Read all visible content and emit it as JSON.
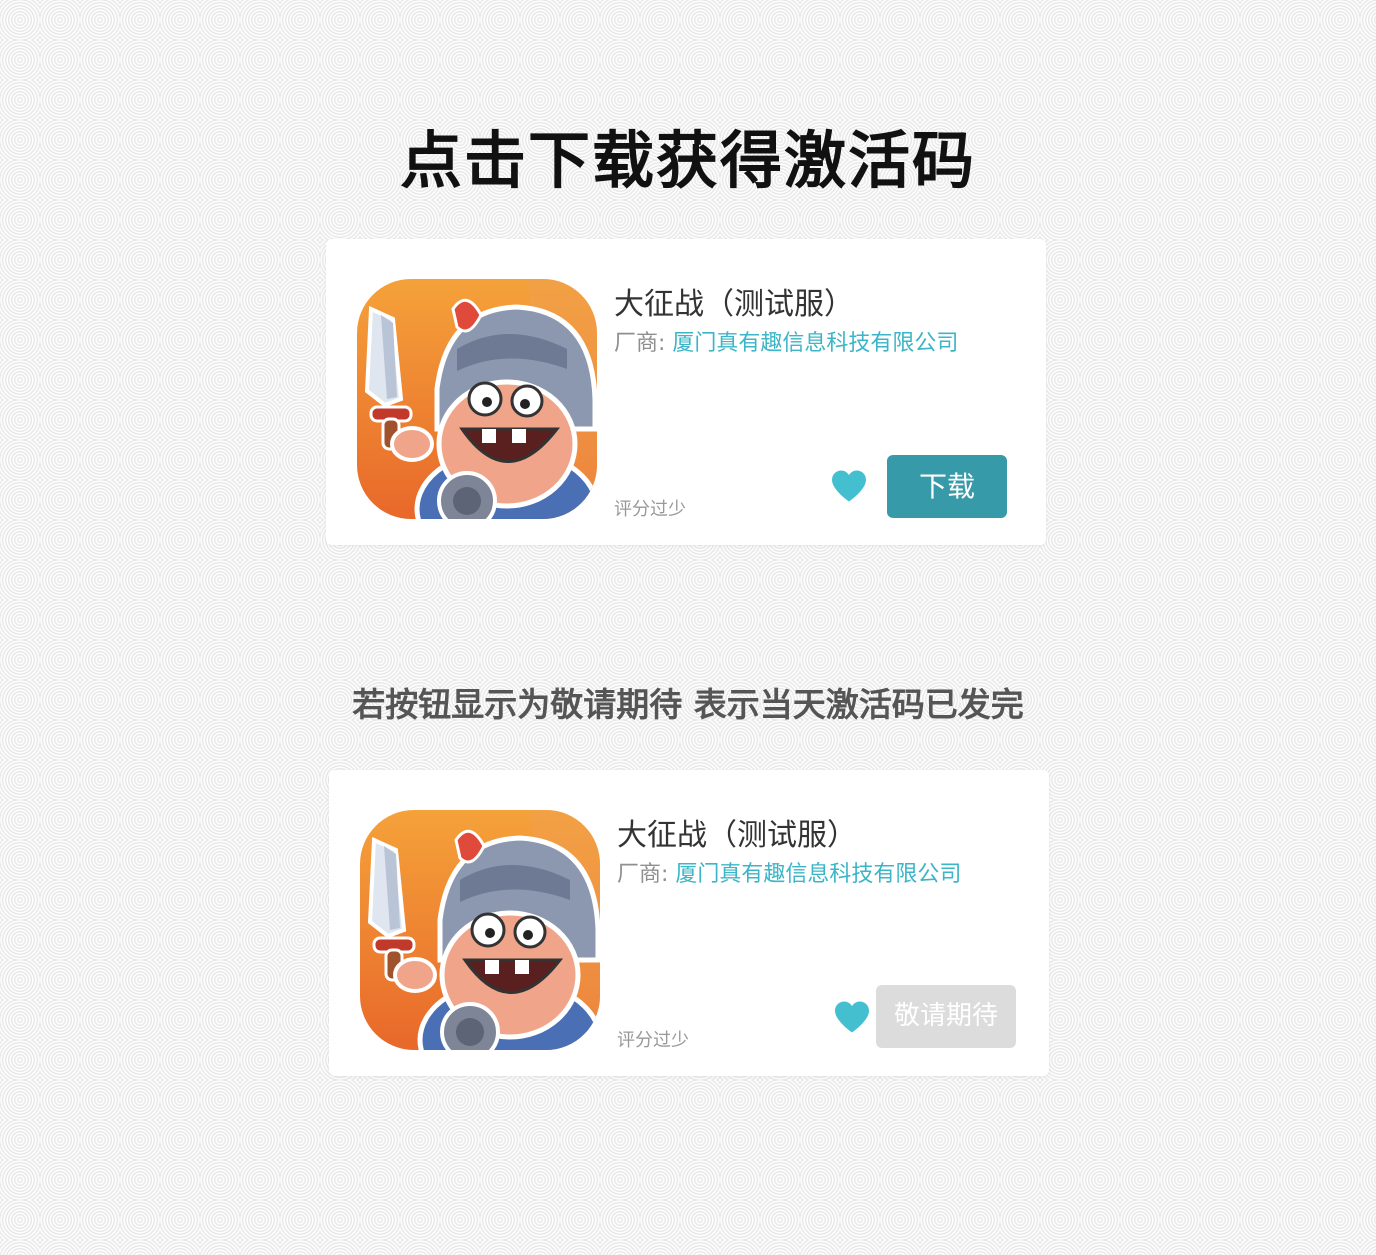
{
  "page": {
    "title": "点击下载获得激活码",
    "notice": "若按钮显示为敬请期待 表示当天激活码已发完"
  },
  "cards": [
    {
      "app_name": "大征战（测试服）",
      "vendor_label": "厂商:",
      "vendor_name": "厦门真有趣信息科技有限公司",
      "rating_text": "评分过少",
      "icon": "heart-icon",
      "button_label": "下载",
      "button_state": "active",
      "button_color": "#379aa8"
    },
    {
      "app_name": "大征战（测试服）",
      "vendor_label": "厂商:",
      "vendor_name": "厦门真有趣信息科技有限公司",
      "rating_text": "评分过少",
      "icon": "heart-icon",
      "button_label": "敬请期待",
      "button_state": "disabled",
      "button_color": "#dcdcdc"
    }
  ],
  "colors": {
    "accent": "#3bb5c7",
    "heart": "#44bfd0"
  }
}
